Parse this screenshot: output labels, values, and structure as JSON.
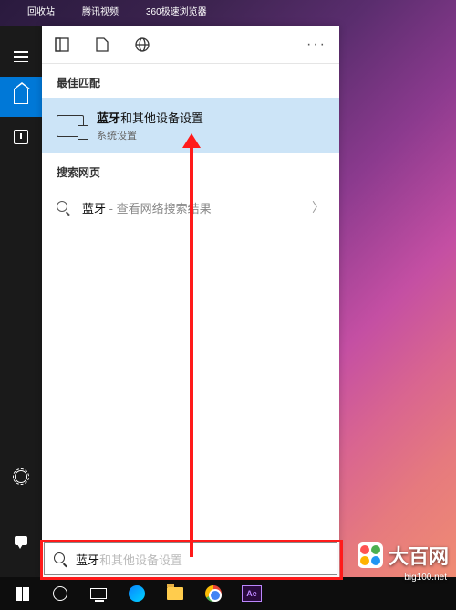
{
  "desktop": {
    "icons": [
      "回收站",
      "腾讯视频",
      "360极速浏览器"
    ]
  },
  "sidebar": {
    "menu": "menu",
    "home": "home",
    "clock": "recent",
    "settings": "settings",
    "feedback": "feedback"
  },
  "panel": {
    "tabs": {
      "apps": "apps",
      "docs": "documents",
      "web": "web",
      "more": "···"
    },
    "best_match_header": "最佳匹配",
    "best_match": {
      "title_bold": "蓝牙",
      "title_rest": "和其他设备设置",
      "subtitle": "系统设置"
    },
    "web_header": "搜索网页",
    "web_row": {
      "term": "蓝牙",
      "suffix": " - 查看网络搜索结果"
    }
  },
  "search": {
    "typed": "蓝牙",
    "ghost": "和其他设备设置"
  },
  "taskbar": {
    "ae_label": "Ae"
  },
  "watermark": {
    "title": "大百网",
    "url": "big100.net"
  }
}
